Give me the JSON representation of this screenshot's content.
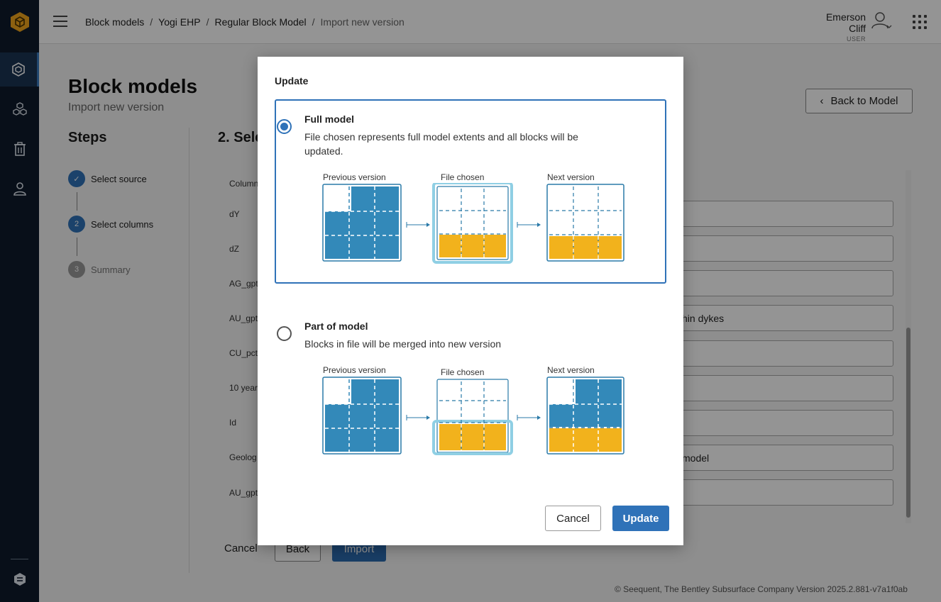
{
  "header": {
    "breadcrumb": [
      "Block models",
      "Yogi EHP",
      "Regular Block Model",
      "Import new version"
    ],
    "user_name": "Emerson Cliff",
    "user_role": "USER"
  },
  "page": {
    "title": "Block models",
    "subtitle": "Import new version",
    "back_to_model": "Back to Model",
    "steps_title": "Steps",
    "steps": [
      {
        "number": "",
        "label": "Select source",
        "state": "done"
      },
      {
        "number": "2",
        "label": "Select columns",
        "state": "active"
      },
      {
        "number": "3",
        "label": "Summary",
        "state": "pending"
      }
    ],
    "section_title": "2. Sele",
    "column_header": "Column",
    "rows": [
      "dY",
      "dZ",
      "AG_gpt",
      "AU_gpt",
      "CU_pct",
      "10 year",
      "Id",
      "Geolog",
      "AU_gpt"
    ],
    "fields": [
      "",
      "",
      "",
      "hin dykes",
      "",
      "",
      "",
      "model",
      ""
    ],
    "cancel": "Cancel",
    "back": "Back",
    "import": "Import",
    "footer": "© Seequent, The Bentley Subsurface Company   Version 2025.2.881-v7a1f0ab"
  },
  "modal": {
    "title": "Update",
    "options": [
      {
        "title": "Full model",
        "description": "File chosen represents full model extents and all blocks will be updated.",
        "selected": true,
        "labels": [
          "Previous version",
          "File chosen",
          "Next version"
        ]
      },
      {
        "title": "Part of model",
        "description": "Blocks in file will be merged into new version",
        "selected": false,
        "labels": [
          "Previous version",
          "File chosen",
          "Next version"
        ]
      }
    ],
    "cancel": "Cancel",
    "update": "Update"
  },
  "colors": {
    "block_blue": "#3389b9",
    "block_yellow": "#f2b21c",
    "primary": "#2f72b8",
    "sidebar": "#0f1a2b"
  }
}
